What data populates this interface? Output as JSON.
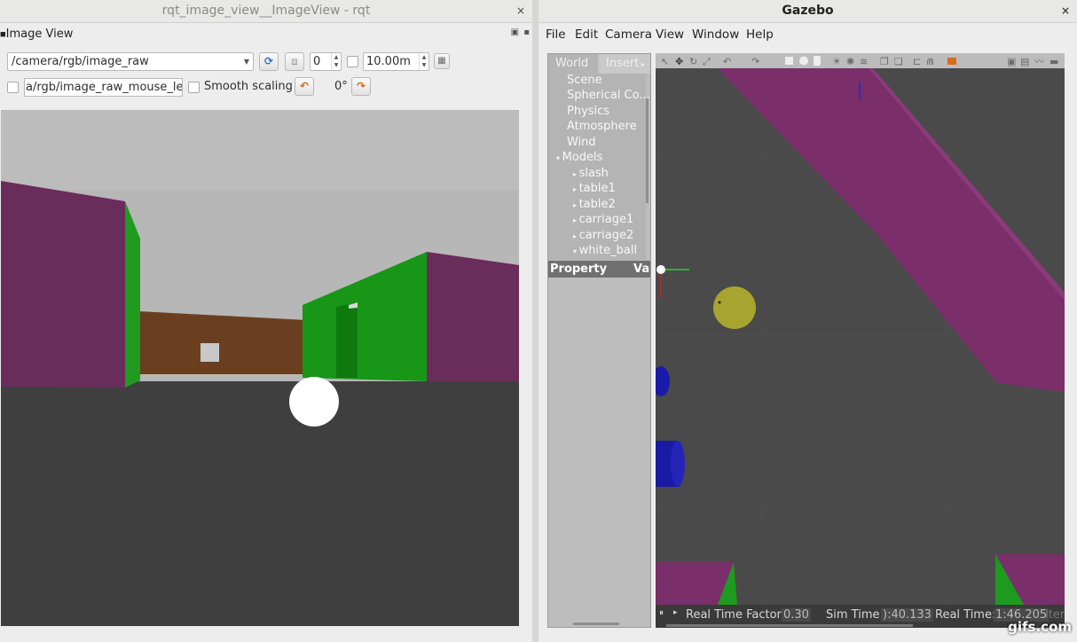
{
  "rqt": {
    "title": "rqt_image_view__ImageView - rqt",
    "close": "×",
    "dock_title": "Image View",
    "dock_buttons": "▣ ▪",
    "topic": "/camera/rgb/image_raw",
    "refresh_icon": "⟳",
    "save_icon": "⧈",
    "depth_value": "0",
    "max_range": "10.00m",
    "fit_icon": "▦",
    "mouse_topic": "a/rgb/image_raw_mouse_left",
    "smooth_scaling_label": "Smooth scaling",
    "rotate_left_icon": "↶",
    "rotation": "0°",
    "rotate_right_icon": "↷"
  },
  "gazebo": {
    "title": "Gazebo",
    "close": "×",
    "menu": [
      "File",
      "Edit",
      "Camera",
      "View",
      "Window",
      "Help"
    ],
    "tabs": {
      "world": "World",
      "insert": "Insert"
    },
    "tree": {
      "scene": "Scene",
      "spherical": "Spherical Co...",
      "physics": "Physics",
      "atmosphere": "Atmosphere",
      "wind": "Wind",
      "models": "Models",
      "models_items": [
        "slash",
        "table1",
        "table2",
        "carriage1",
        "carriage2",
        "white_ball"
      ]
    },
    "property_header": "Property",
    "value_header": "Val",
    "status": {
      "pause_icon": "⏸",
      "rtf_label": "Real Time Factor:",
      "rtf_value": "0.30",
      "sim_label": "Sim Time:",
      "sim_value": "):40.133",
      "real_label": "Real Time:",
      "real_value": "1:46.205",
      "iter_label": "Iter"
    }
  },
  "watermark": "gifs.com",
  "colors": {
    "wall_purple": "#6b2a5a",
    "wall_green": "#1f9a1f",
    "ball_yellow": "#a8a430",
    "ground": "#3f3f3f"
  }
}
